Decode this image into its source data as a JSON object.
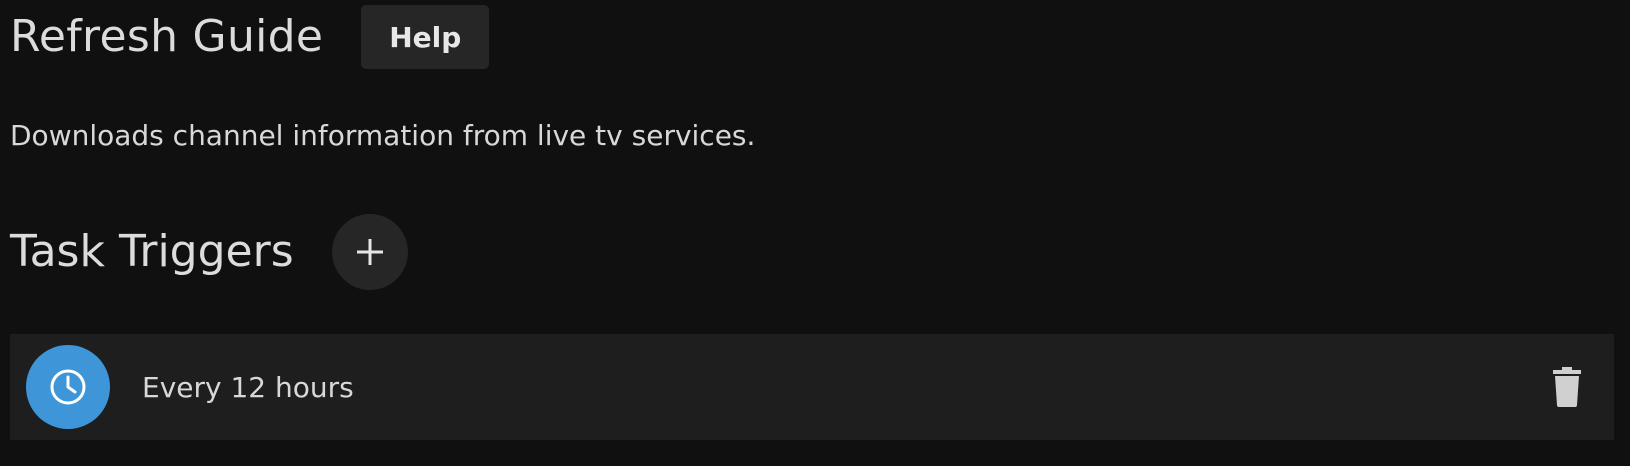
{
  "header": {
    "title": "Refresh Guide",
    "help_label": "Help"
  },
  "description": "Downloads channel information from live tv services.",
  "triggers_section": {
    "title": "Task Triggers",
    "add_icon": "plus-icon",
    "items": [
      {
        "icon": "clock-icon",
        "label": "Every 12 hours",
        "delete_icon": "trash-icon"
      }
    ]
  },
  "colors": {
    "background": "#101010",
    "button": "#262626",
    "row": "#1e1e1e",
    "accent": "#3e96d8",
    "text": "#dcdcdc"
  }
}
